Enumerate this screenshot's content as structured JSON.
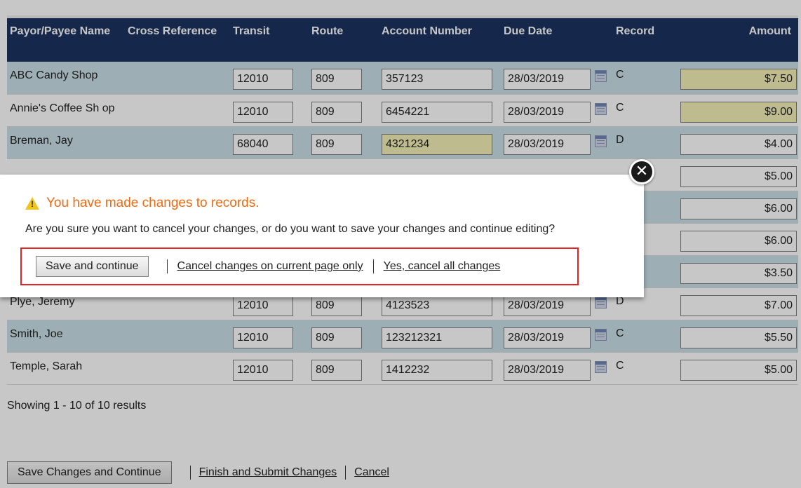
{
  "table": {
    "headers": {
      "name": "Payor/Payee Name",
      "cross_reference": "Cross Reference",
      "transit": "Transit",
      "route": "Route",
      "account_number": "Account Number",
      "due_date": "Due Date",
      "record": "Record",
      "amount": "Amount"
    },
    "rows": [
      {
        "name": "ABC Candy Shop",
        "cross": "",
        "transit": "12010",
        "route": "809",
        "account": "357123",
        "due": "28/03/2019",
        "record": "C",
        "amount": "$7.50"
      },
      {
        "name": "Annie's Coffee Sh op",
        "cross": "",
        "transit": "12010",
        "route": "809",
        "account": "6454221",
        "due": "28/03/2019",
        "record": "C",
        "amount": "$9.00"
      },
      {
        "name": "Breman, Jay",
        "cross": "",
        "transit": "68040",
        "route": "809",
        "account": "4321234",
        "due": "28/03/2019",
        "record": "D",
        "amount": "$4.00"
      },
      {
        "name": "",
        "cross": "",
        "transit": "",
        "route": "",
        "account": "",
        "due": "",
        "record": "",
        "amount": "$5.00"
      },
      {
        "name": "",
        "cross": "",
        "transit": "",
        "route": "",
        "account": "",
        "due": "",
        "record": "",
        "amount": "$6.00"
      },
      {
        "name": "",
        "cross": "",
        "transit": "",
        "route": "",
        "account": "",
        "due": "",
        "record": "",
        "amount": "$6.00"
      },
      {
        "name": "",
        "cross": "",
        "transit": "",
        "route": "",
        "account": "",
        "due": "",
        "record": "",
        "amount": "$3.50"
      },
      {
        "name": "Plye, Jeremy",
        "cross": "",
        "transit": "12010",
        "route": "809",
        "account": "4123523",
        "due": "28/03/2019",
        "record": "D",
        "amount": "$7.00"
      },
      {
        "name": "Smith, Joe",
        "cross": "",
        "transit": "12010",
        "route": "809",
        "account": "123212321",
        "due": "28/03/2019",
        "record": "C",
        "amount": "$5.50"
      },
      {
        "name": "Temple, Sarah",
        "cross": "",
        "transit": "12010",
        "route": "809",
        "account": "1412232",
        "due": "28/03/2019",
        "record": "C",
        "amount": "$5.00"
      }
    ]
  },
  "results_text": "Showing 1 - 10 of 10 results",
  "footer": {
    "save_label": "Save Changes and Continue",
    "finish_label": "Finish and Submit Changes",
    "cancel_label": "Cancel"
  },
  "modal": {
    "title": "You have made changes to records.",
    "message": "Are you sure you want to cancel your changes, or do you want to save your changes and continue editing?",
    "save_label": "Save and continue",
    "cancel_page_label": "Cancel changes on current page only",
    "cancel_all_label": "Yes, cancel all changes",
    "close_glyph": "✕"
  },
  "colors": {
    "header_bg": "#1c3461",
    "row_alt_bg": "#c9e0e8",
    "highlight_input": "#f4f0b7",
    "warning_text": "#ef6a10",
    "focus_border": "#e32222"
  }
}
